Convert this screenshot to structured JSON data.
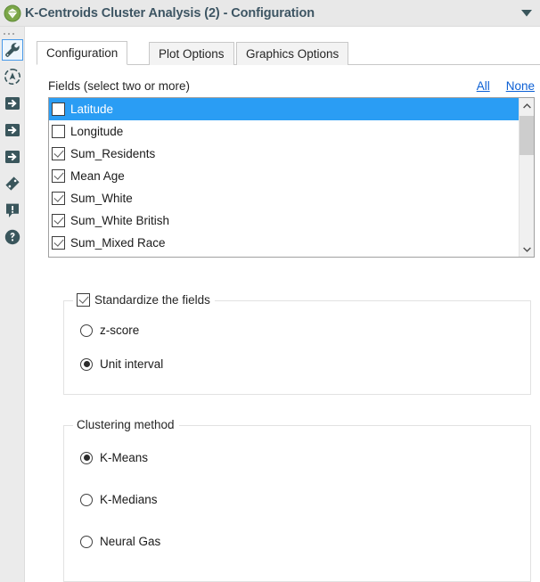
{
  "window": {
    "title": "K-Centroids Cluster Analysis (2) - Configuration",
    "app_icon": "alteryx-diamond-icon",
    "collapse_icon": "chevron-down-icon"
  },
  "rail": {
    "grip": "drag-grip-dots",
    "items": [
      {
        "name": "configuration-wrench-icon",
        "icon": "wrench-icon",
        "selected": true
      },
      {
        "name": "annotation-target-icon",
        "icon": "target-icon",
        "selected": false
      },
      {
        "name": "input-arrow-icon-1",
        "icon": "arrow-right-box-icon",
        "selected": false
      },
      {
        "name": "input-arrow-icon-2",
        "icon": "arrow-right-box-icon",
        "selected": false
      },
      {
        "name": "input-arrow-icon-3",
        "icon": "arrow-right-box-icon",
        "selected": false
      },
      {
        "name": "tag-icon",
        "icon": "tag-icon",
        "selected": false
      },
      {
        "name": "message-alert-icon",
        "icon": "comment-exclamation-icon",
        "selected": false
      },
      {
        "name": "help-icon",
        "icon": "question-circle-icon",
        "selected": false
      }
    ]
  },
  "tabs": [
    {
      "label": "Configuration",
      "active": true
    },
    {
      "label": "Plot Options",
      "active": false
    },
    {
      "label": "Graphics Options",
      "active": false
    }
  ],
  "fields_section": {
    "label": "Fields (select two or more)",
    "all_link": "All",
    "none_link": "None",
    "items": [
      {
        "label": "Latitude",
        "checked": false,
        "selected": true
      },
      {
        "label": "Longitude",
        "checked": false,
        "selected": false
      },
      {
        "label": "Sum_Residents",
        "checked": true,
        "selected": false
      },
      {
        "label": "Mean Age",
        "checked": true,
        "selected": false
      },
      {
        "label": "Sum_White",
        "checked": true,
        "selected": false
      },
      {
        "label": "Sum_White British",
        "checked": true,
        "selected": false
      },
      {
        "label": "Sum_Mixed Race",
        "checked": true,
        "selected": false
      }
    ],
    "scroll_up_icon": "chevron-up-icon",
    "scroll_down_icon": "chevron-down-icon"
  },
  "standardize_section": {
    "title": "Standardize the fields",
    "checked": true,
    "options": [
      {
        "label": "z-score",
        "selected": false
      },
      {
        "label": "Unit interval",
        "selected": true
      }
    ]
  },
  "clustering_section": {
    "title": "Clustering method",
    "options": [
      {
        "label": "K-Means",
        "selected": true
      },
      {
        "label": "K-Medians",
        "selected": false
      },
      {
        "label": "Neural Gas",
        "selected": false
      }
    ]
  },
  "colors": {
    "titlebar_bg": "#e8e8e8",
    "title_text": "#3d5563",
    "rail_bg": "#ebebeb",
    "icon_dark": "#3a565c",
    "selection_blue": "#2a9df4",
    "link_blue": "#0b5fd4",
    "accent_green": "#6aa84f"
  }
}
